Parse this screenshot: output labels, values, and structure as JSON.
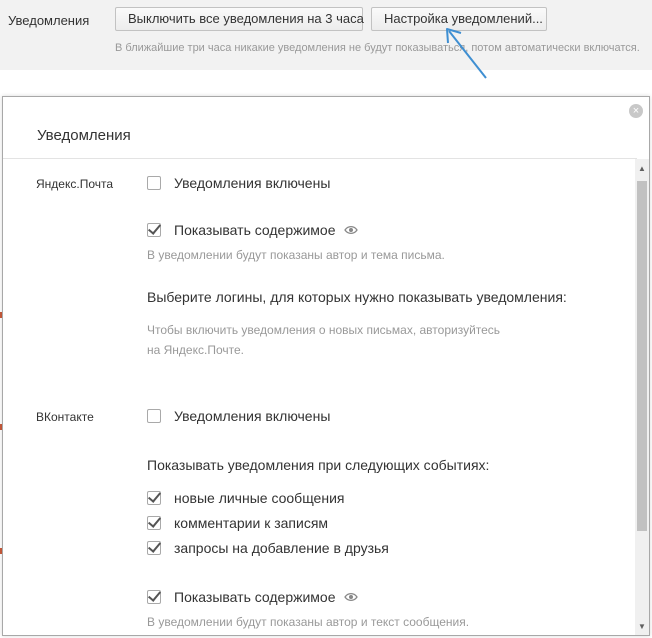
{
  "top": {
    "label": "Уведомления",
    "disable_button": "Выключить все уведомления на 3 часа",
    "config_button": "Настройка уведомлений...",
    "hint": "В ближайшие три часа никакие уведомления не будут показываться, потом автоматически включатся."
  },
  "dialog": {
    "title": "Уведомления",
    "close": "×",
    "yandex": {
      "label": "Яндекс.Почта",
      "enabled_label": "Уведомления включены",
      "enabled": false,
      "show_content_label": "Показывать содержимое",
      "show_content": true,
      "show_content_hint": "В уведомлении будут показаны автор и тема письма.",
      "logins_heading": "Выберите логины, для которых нужно показывать уведомления:",
      "logins_hint_1": "Чтобы включить уведомления о новых письмах, авторизуйтесь",
      "logins_hint_2": "на Яндекс.Почте."
    },
    "vk": {
      "label": "ВКонтакте",
      "enabled_label": "Уведомления включены",
      "enabled": false,
      "events_heading": "Показывать уведомления при следующих событиях:",
      "events": [
        {
          "label": "новые личные сообщения",
          "checked": true
        },
        {
          "label": "комментарии к записям",
          "checked": true
        },
        {
          "label": "запросы на добавление в друзья",
          "checked": true
        }
      ],
      "show_content_label": "Показывать содержимое",
      "show_content": true,
      "show_content_hint": "В уведомлении будут показаны автор и текст сообщения."
    }
  },
  "colors": {
    "arrow": "#3f8fd2",
    "hint_text": "#999999"
  },
  "icons": {
    "close": "close-icon",
    "eye": "eye-icon",
    "arrow": "arrow-annotation-icon"
  }
}
